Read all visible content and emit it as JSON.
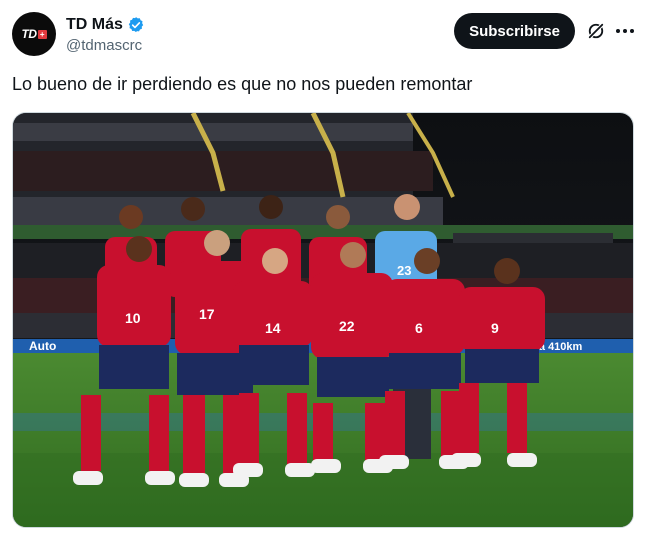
{
  "author": {
    "display_name": "TD Más",
    "handle": "@tdmascrc",
    "avatar_text": "TD",
    "avatar_badge": "+",
    "verified": true
  },
  "actions": {
    "subscribe_label": "Subscribirse",
    "grok_icon": "grok-icon",
    "more_icon": "more-icon"
  },
  "post": {
    "text": "Lo bueno de ir perdiendo es que no nos pueden remontar"
  },
  "media": {
    "board_text_left": "Auto",
    "board_text_right": "de a 410km",
    "jersey_numbers_front": [
      "10",
      "17",
      "14",
      "22",
      "6",
      "9"
    ],
    "jersey_numbers_back": [
      "23"
    ]
  },
  "colors": {
    "primary_button": "#0f1419",
    "verified_blue": "#1d9bf0",
    "jersey_red": "#c8102e",
    "shorts_navy": "#1c2a5e",
    "keeper_blue": "#5aa9e6",
    "pitch_green": "#3f7d2a"
  }
}
